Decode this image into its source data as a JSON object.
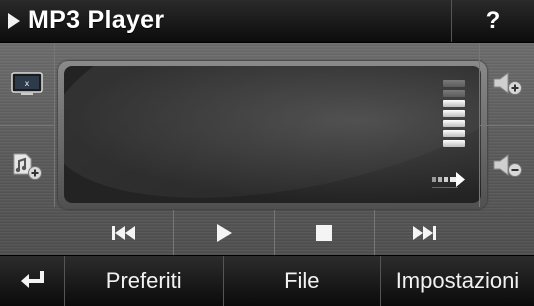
{
  "header": {
    "title": "MP3 Player",
    "help_label": "?"
  },
  "side_left": [
    {
      "icon": "screen-off-icon"
    },
    {
      "icon": "add-to-playlist-icon"
    }
  ],
  "side_right": [
    {
      "icon": "volume-up-icon"
    },
    {
      "icon": "volume-down-icon"
    }
  ],
  "volume": {
    "level": 0.7,
    "bars_total": 7,
    "bars_lit": 5
  },
  "transport": [
    {
      "icon": "previous-track-icon"
    },
    {
      "icon": "play-icon"
    },
    {
      "icon": "stop-icon"
    },
    {
      "icon": "next-track-icon"
    }
  ],
  "bottom_bar": {
    "back_icon": "back-return-icon",
    "favorites_label": "Preferiti",
    "file_label": "File",
    "settings_label": "Impostazioni"
  },
  "colors": {
    "accent": "#ffffff",
    "bar_dark": "#0b0b0b",
    "metal": "#5f5f5f"
  }
}
